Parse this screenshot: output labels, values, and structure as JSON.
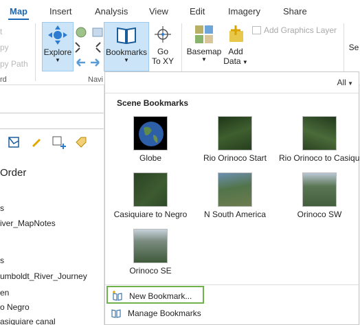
{
  "tabs": [
    "Map",
    "Insert",
    "Analysis",
    "View",
    "Edit",
    "Imagery",
    "Share"
  ],
  "ribbon": {
    "clipboard_partial": {
      "cut": "t",
      "copy": "py",
      "copy_path": "py Path",
      "group": "rd"
    },
    "explore_label": "Explore",
    "bookmarks_label": "Bookmarks",
    "goto_line1": "Go",
    "goto_line2": "To XY",
    "navigate_group": "Navi",
    "basemap_label": "Basemap",
    "add_data_line1": "Add",
    "add_data_line2": "Data",
    "add_graphics_layer": "Add Graphics Layer",
    "select_partial": "Se"
  },
  "left_pane": {
    "heading": "Order",
    "items": [
      "s",
      "iver_MapNotes",
      "s",
      "umboldt_River_Journey",
      "en",
      "o Negro",
      "asiquiare canal"
    ]
  },
  "dropdown": {
    "filter_label": "All",
    "section_title": "Scene Bookmarks",
    "bookmarks": [
      {
        "label": "Globe"
      },
      {
        "label": "Rio Orinoco Start"
      },
      {
        "label": "Rio Orinoco to Casiquiare"
      },
      {
        "label": "Casiquiare to Negro"
      },
      {
        "label": "N South America"
      },
      {
        "label": "Orinoco SW"
      },
      {
        "label": "Orinoco SE"
      }
    ],
    "new_bookmark": "New Bookmark...",
    "manage_bookmarks": "Manage Bookmarks"
  },
  "colors": {
    "accent": "#1a67b4",
    "active_button": "#cbe4f7",
    "highlight_border": "#6fb14a"
  }
}
